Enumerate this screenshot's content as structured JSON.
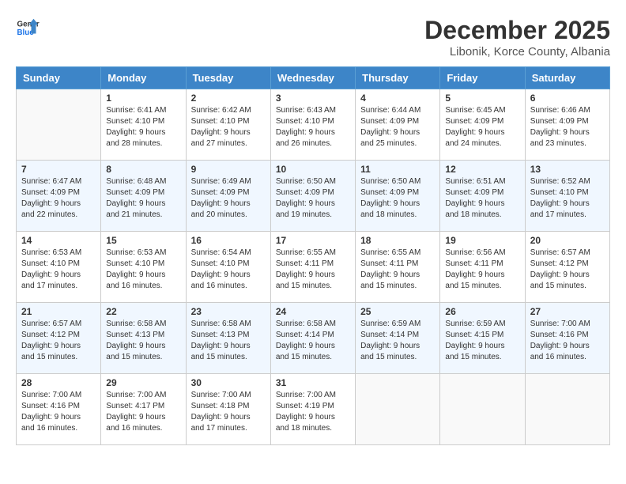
{
  "logo": {
    "line1": "General",
    "line2": "Blue"
  },
  "title": "December 2025",
  "location": "Libonik, Korce County, Albania",
  "weekdays": [
    "Sunday",
    "Monday",
    "Tuesday",
    "Wednesday",
    "Thursday",
    "Friday",
    "Saturday"
  ],
  "weeks": [
    [
      {
        "day": "",
        "info": ""
      },
      {
        "day": "1",
        "info": "Sunrise: 6:41 AM\nSunset: 4:10 PM\nDaylight: 9 hours\nand 28 minutes."
      },
      {
        "day": "2",
        "info": "Sunrise: 6:42 AM\nSunset: 4:10 PM\nDaylight: 9 hours\nand 27 minutes."
      },
      {
        "day": "3",
        "info": "Sunrise: 6:43 AM\nSunset: 4:10 PM\nDaylight: 9 hours\nand 26 minutes."
      },
      {
        "day": "4",
        "info": "Sunrise: 6:44 AM\nSunset: 4:09 PM\nDaylight: 9 hours\nand 25 minutes."
      },
      {
        "day": "5",
        "info": "Sunrise: 6:45 AM\nSunset: 4:09 PM\nDaylight: 9 hours\nand 24 minutes."
      },
      {
        "day": "6",
        "info": "Sunrise: 6:46 AM\nSunset: 4:09 PM\nDaylight: 9 hours\nand 23 minutes."
      }
    ],
    [
      {
        "day": "7",
        "info": "Sunrise: 6:47 AM\nSunset: 4:09 PM\nDaylight: 9 hours\nand 22 minutes."
      },
      {
        "day": "8",
        "info": "Sunrise: 6:48 AM\nSunset: 4:09 PM\nDaylight: 9 hours\nand 21 minutes."
      },
      {
        "day": "9",
        "info": "Sunrise: 6:49 AM\nSunset: 4:09 PM\nDaylight: 9 hours\nand 20 minutes."
      },
      {
        "day": "10",
        "info": "Sunrise: 6:50 AM\nSunset: 4:09 PM\nDaylight: 9 hours\nand 19 minutes."
      },
      {
        "day": "11",
        "info": "Sunrise: 6:50 AM\nSunset: 4:09 PM\nDaylight: 9 hours\nand 18 minutes."
      },
      {
        "day": "12",
        "info": "Sunrise: 6:51 AM\nSunset: 4:09 PM\nDaylight: 9 hours\nand 18 minutes."
      },
      {
        "day": "13",
        "info": "Sunrise: 6:52 AM\nSunset: 4:10 PM\nDaylight: 9 hours\nand 17 minutes."
      }
    ],
    [
      {
        "day": "14",
        "info": "Sunrise: 6:53 AM\nSunset: 4:10 PM\nDaylight: 9 hours\nand 17 minutes."
      },
      {
        "day": "15",
        "info": "Sunrise: 6:53 AM\nSunset: 4:10 PM\nDaylight: 9 hours\nand 16 minutes."
      },
      {
        "day": "16",
        "info": "Sunrise: 6:54 AM\nSunset: 4:10 PM\nDaylight: 9 hours\nand 16 minutes."
      },
      {
        "day": "17",
        "info": "Sunrise: 6:55 AM\nSunset: 4:11 PM\nDaylight: 9 hours\nand 15 minutes."
      },
      {
        "day": "18",
        "info": "Sunrise: 6:55 AM\nSunset: 4:11 PM\nDaylight: 9 hours\nand 15 minutes."
      },
      {
        "day": "19",
        "info": "Sunrise: 6:56 AM\nSunset: 4:11 PM\nDaylight: 9 hours\nand 15 minutes."
      },
      {
        "day": "20",
        "info": "Sunrise: 6:57 AM\nSunset: 4:12 PM\nDaylight: 9 hours\nand 15 minutes."
      }
    ],
    [
      {
        "day": "21",
        "info": "Sunrise: 6:57 AM\nSunset: 4:12 PM\nDaylight: 9 hours\nand 15 minutes."
      },
      {
        "day": "22",
        "info": "Sunrise: 6:58 AM\nSunset: 4:13 PM\nDaylight: 9 hours\nand 15 minutes."
      },
      {
        "day": "23",
        "info": "Sunrise: 6:58 AM\nSunset: 4:13 PM\nDaylight: 9 hours\nand 15 minutes."
      },
      {
        "day": "24",
        "info": "Sunrise: 6:58 AM\nSunset: 4:14 PM\nDaylight: 9 hours\nand 15 minutes."
      },
      {
        "day": "25",
        "info": "Sunrise: 6:59 AM\nSunset: 4:14 PM\nDaylight: 9 hours\nand 15 minutes."
      },
      {
        "day": "26",
        "info": "Sunrise: 6:59 AM\nSunset: 4:15 PM\nDaylight: 9 hours\nand 15 minutes."
      },
      {
        "day": "27",
        "info": "Sunrise: 7:00 AM\nSunset: 4:16 PM\nDaylight: 9 hours\nand 16 minutes."
      }
    ],
    [
      {
        "day": "28",
        "info": "Sunrise: 7:00 AM\nSunset: 4:16 PM\nDaylight: 9 hours\nand 16 minutes."
      },
      {
        "day": "29",
        "info": "Sunrise: 7:00 AM\nSunset: 4:17 PM\nDaylight: 9 hours\nand 16 minutes."
      },
      {
        "day": "30",
        "info": "Sunrise: 7:00 AM\nSunset: 4:18 PM\nDaylight: 9 hours\nand 17 minutes."
      },
      {
        "day": "31",
        "info": "Sunrise: 7:00 AM\nSunset: 4:19 PM\nDaylight: 9 hours\nand 18 minutes."
      },
      {
        "day": "",
        "info": ""
      },
      {
        "day": "",
        "info": ""
      },
      {
        "day": "",
        "info": ""
      }
    ]
  ]
}
